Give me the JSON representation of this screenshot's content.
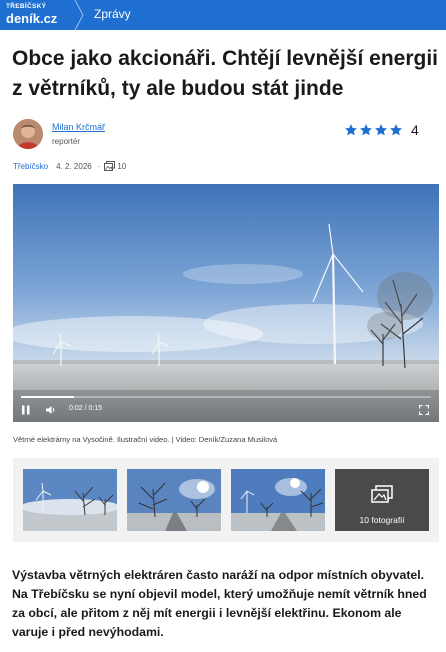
{
  "header": {
    "brand_small": "TŘEBÍČSKÝ",
    "brand_big": "deník.cz",
    "nav_label": "Zprávy"
  },
  "article": {
    "title": "Obce jako akcionáři. Chtějí levnější energii z větrníků, ty ale budou stát jinde",
    "author": {
      "name": "Milan Krčmář",
      "role": "reportér"
    },
    "rating": {
      "stars": 4,
      "max": 5,
      "count": "4"
    },
    "region": "Třebíčsko",
    "date": "4. 2. 2026",
    "photo_count": "10",
    "video": {
      "current_time": "0:02",
      "duration": "0:15",
      "progress": 0.13
    },
    "caption": "Větrné elektrárny na Vysočině. Ilustrační video. | Video: Deník/Zuzana Musilová",
    "gallery_more_label": "10 fotografií",
    "perex": "Výstavba větrných elektráren často naráží na odpor místních obyvatel. Na Třebíčsku se nyní objevil model, který umožňuje nemít větrník hned za obcí, ale přitom z něj mít energii i levnější elektřinu. Ekonom ale varuje i před nevýhodami."
  },
  "colors": {
    "brand_blue": "#1f6fd1",
    "star_blue": "#1f6fd1"
  },
  "icons": {
    "play": "play-icon",
    "volume": "volume-icon",
    "fullscreen": "fullscreen-icon",
    "photos": "photos-icon"
  }
}
